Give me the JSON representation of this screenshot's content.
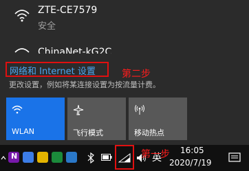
{
  "networks": [
    {
      "name": "ZTE-CE7579",
      "status": "安全"
    },
    {
      "name": "ChinaNet-kG2C"
    }
  ],
  "settings": {
    "link_label": "网络和 Internet 设置",
    "description": "更改设置，例如将某连接设置为按流量计费。"
  },
  "annotations": {
    "step2": "第二步",
    "step1": "第一步"
  },
  "tiles": [
    {
      "label": "WLAN",
      "icon": "wifi-icon",
      "active": true,
      "color": "#1a73e8"
    },
    {
      "label": "飞行模式",
      "icon": "airplane-icon",
      "active": false,
      "color": "#585858"
    },
    {
      "label": "移动热点",
      "icon": "hotspot-icon",
      "active": false,
      "color": "#585858"
    }
  ],
  "taskbar": {
    "ime": "英",
    "time": "16:05",
    "date": "2020/7/19",
    "icons": [
      "onenote-icon",
      "app-icon",
      "game-icon",
      "sync-icon",
      "bluetooth-icon",
      "battery-icon",
      "network-icon",
      "volume-icon",
      "notification-icon"
    ]
  },
  "colors": {
    "accent": "#1a73e8",
    "link": "#4ea6f0",
    "highlight": "#e01010"
  }
}
